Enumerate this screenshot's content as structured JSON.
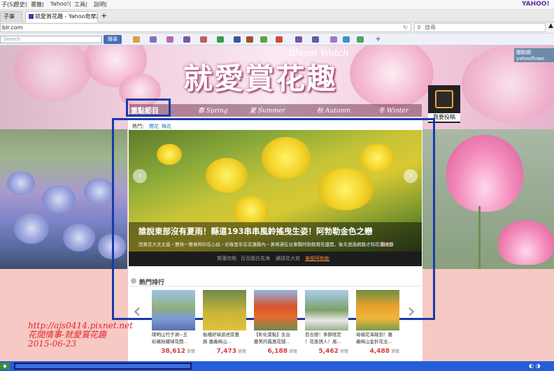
{
  "menubar": {
    "items": [
      "子(S)",
      "歷史(",
      "書籤(",
      "Yahoo!(",
      "工具(",
      "說明("
    ],
    "brand": "YAHOO!"
  },
  "tabs": [
    {
      "label": "子事"
    },
    {
      "label": "就愛賞花趣 - Yahoo奇摩旅遊"
    }
  ],
  "newtab": "+",
  "address": {
    "value": "blr.com",
    "search_placeholder": "搜尋"
  },
  "toolbar": {
    "search_placeholder": "Search",
    "search_button": "搜尋"
  },
  "banner": {
    "title_en": "Bloom Watch",
    "title_zh": "就愛賞花趣",
    "gallery": "圖飴網 yahooflowe",
    "submit": "我要投稿"
  },
  "seasons": [
    {
      "label": "重點節目"
    },
    {
      "label": "Spring",
      "mark": "春"
    },
    {
      "label": "Summer",
      "mark": "夏"
    },
    {
      "label": "Autumn",
      "mark": "秋"
    },
    {
      "label": "Winter",
      "mark": "冬"
    }
  ],
  "hot": {
    "label": "熱門：",
    "links": [
      "櫻花",
      "梅花"
    ]
  },
  "slide": {
    "title": "誰說東部沒有夏雨！縣道193串串風鈴搖曳生姿！阿勃勒金色之戀",
    "desc": "因黃花大夫太過・雙燕一整條阿印在心底・初春里年在花蓮縣內・黃瑤通在台東縣阿勃勒賞花盛開，後夫透過網路才知花蓮阿勃",
    "more": "看更多",
    "tabs": [
      "賞蓮攻略",
      "百合園白花海",
      "繡球花大放",
      "東部阿勃勒"
    ],
    "active_tab": 3
  },
  "ranking": {
    "title": "熱門排行",
    "cards": [
      {
        "text": "陽明山竹子湖~五\n彩繽紛繡球花開…",
        "views": "38,612",
        "unit": "瀏覽"
      },
      {
        "text": "板橋好綠遊虎區豐\n路 嘉義梅山…",
        "views": "7,473",
        "unit": "瀏覽"
      },
      {
        "text": "【彰化景點】生台\n慶美的鳳凰花隧…",
        "views": "6,188",
        "unit": "瀏覽"
      },
      {
        "text": "百合戀！季節限定\n！花香誘人！風…",
        "views": "5,462",
        "unit": "瀏覽"
      },
      {
        "text": "母親花海報到！嘉\n義梅山金針花全…",
        "views": "4,488",
        "unit": "瀏覽"
      }
    ]
  },
  "watermark": {
    "lines": [
      "http://ajs0414.pixnet.net",
      "花間情事-就愛賞花趣",
      "2015-06-23"
    ]
  },
  "colors": {
    "highlight": "#1a3aa8",
    "page_bg": "#f6c9c4",
    "taskbar": "#245edb"
  }
}
